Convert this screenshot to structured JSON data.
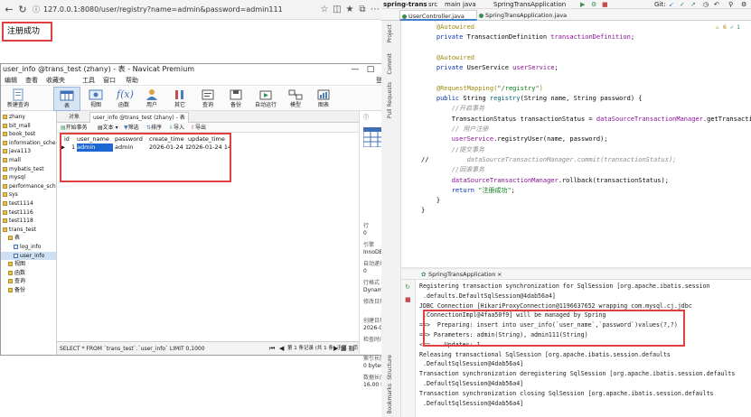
{
  "browser": {
    "url": "127.0.0.1:8080/user/registry?name=admin&password=admin111",
    "page_text": "注册成功"
  },
  "navicat": {
    "title": "user_info @trans_test (zhany) - 表 - Navicat Premium",
    "login": "登录",
    "menu": [
      "编辑",
      "查看",
      "收藏夹",
      "工具",
      "窗口",
      "帮助"
    ],
    "toolbar": [
      "新建查询",
      "表",
      "视图",
      "函数",
      "用户",
      "其它",
      "查询",
      "备份",
      "自动运行",
      "模型",
      "图表"
    ],
    "tabs": {
      "objects": "对象",
      "table": "user_info @trans_test (zhany) - 表"
    },
    "subtoolbar": [
      "开始事务",
      "文本",
      "筛选",
      "排序",
      "导入",
      "导出"
    ],
    "sidebar": [
      {
        "label": "zhany",
        "level": 0
      },
      {
        "label": "bit_mall",
        "level": 0
      },
      {
        "label": "book_test",
        "level": 0
      },
      {
        "label": "information_schema",
        "level": 0
      },
      {
        "label": "java113",
        "level": 0
      },
      {
        "label": "mall",
        "level": 0
      },
      {
        "label": "mybatis_test",
        "level": 0
      },
      {
        "label": "mysql",
        "level": 0
      },
      {
        "label": "performance_schema",
        "level": 0
      },
      {
        "label": "sys",
        "level": 0
      },
      {
        "label": "test1114",
        "level": 0
      },
      {
        "label": "test1116",
        "level": 0
      },
      {
        "label": "test1118",
        "level": 0
      },
      {
        "label": "trans_test",
        "level": 0
      },
      {
        "label": "表",
        "level": 1
      },
      {
        "label": "log_info",
        "level": 2
      },
      {
        "label": "user_info",
        "level": 2,
        "selected": true
      },
      {
        "label": "视图",
        "level": 1
      },
      {
        "label": "函数",
        "level": 1
      },
      {
        "label": "查询",
        "level": 1
      },
      {
        "label": "备份",
        "level": 1
      }
    ],
    "grid": {
      "columns": [
        "id",
        "user_name",
        "password",
        "create_time",
        "update_time"
      ],
      "rows": [
        [
          "1",
          "admin",
          "admin",
          "2026-01-24 14",
          "2026-01-24 14:"
        ]
      ]
    },
    "info": [
      {
        "k": "行",
        "v": "0"
      },
      {
        "k": "引擎",
        "v": "InnoDB"
      },
      {
        "k": "自动递增",
        "v": "0"
      },
      {
        "k": "行格式",
        "v": "Dynamic"
      },
      {
        "k": "修改日期",
        "v": ""
      },
      {
        "k": "创建日期",
        "v": "2026-01-2"
      },
      {
        "k": "检查时间",
        "v": ""
      },
      {
        "k": "索引长度",
        "v": "0 bytes (0)"
      },
      {
        "k": "数据长度",
        "v": "16.00 KB ("
      }
    ],
    "status": {
      "sql": "SELECT * FROM `trans_test`.`user_info` LIMIT 0,1000",
      "record": "第 1 条记录 (共 1 条) 于第 1 页"
    }
  },
  "ide": {
    "project": "spring-trans",
    "crumbs": [
      "src",
      "main",
      "java"
    ],
    "run_config": "SpringTransApplication",
    "tabs": [
      "UserController.java",
      "SpringTransApplication.java"
    ],
    "left_strip": [
      "Project",
      "Commit",
      "Pull Requests"
    ],
    "warnings": "6",
    "errors": "1",
    "code_lines": [
      [
        {
          "t": "    "
        },
        {
          "t": "@Autowired",
          "c": "ann"
        }
      ],
      [
        {
          "t": "    "
        },
        {
          "t": "private ",
          "c": "kw"
        },
        {
          "t": "TransactionDefinition "
        },
        {
          "t": "transactionDefinition",
          "c": "fd"
        },
        {
          "t": ";"
        }
      ],
      [
        {
          "t": ""
        }
      ],
      [
        {
          "t": "    "
        },
        {
          "t": "@Autowired",
          "c": "ann"
        }
      ],
      [
        {
          "t": "    "
        },
        {
          "t": "private ",
          "c": "kw"
        },
        {
          "t": "UserService "
        },
        {
          "t": "userService",
          "c": "fd"
        },
        {
          "t": ";"
        }
      ],
      [
        {
          "t": ""
        }
      ],
      [
        {
          "t": "    "
        },
        {
          "t": "@RequestMapping(",
          "c": "ann"
        },
        {
          "t": "\"/registry\"",
          "c": "str"
        },
        {
          "t": ")",
          "c": "ann"
        }
      ],
      [
        {
          "t": "    "
        },
        {
          "t": "public ",
          "c": "kw"
        },
        {
          "t": "String "
        },
        {
          "t": "registry",
          "c": "mth"
        },
        {
          "t": "(String name, String password) {"
        }
      ],
      [
        {
          "t": "        "
        },
        {
          "t": "//开启事务",
          "c": "cm"
        }
      ],
      [
        {
          "t": "        TransactionStatus transactionStatus = "
        },
        {
          "t": "dataSourceTransactionManager",
          "c": "fd"
        },
        {
          "t": ".getTransaction(tr"
        }
      ],
      [
        {
          "t": "        "
        },
        {
          "t": "// 用户注册",
          "c": "cm"
        }
      ],
      [
        {
          "t": "        "
        },
        {
          "t": "userService",
          "c": "fd"
        },
        {
          "t": ".registryUser(name, password);"
        }
      ],
      [
        {
          "t": "        "
        },
        {
          "t": "//提交事务",
          "c": "cm"
        }
      ],
      [
        {
          "t": "//          "
        },
        {
          "t": "dataSourceTransactionManager.commit(transactionStatus);",
          "c": "cm"
        }
      ],
      [
        {
          "t": "        "
        },
        {
          "t": "//回滚事务",
          "c": "cm"
        }
      ],
      [
        {
          "t": "        "
        },
        {
          "t": "dataSourceTransactionManager",
          "c": "fd"
        },
        {
          "t": ".rollback(transactionStatus);"
        }
      ],
      [
        {
          "t": "        "
        },
        {
          "t": "return ",
          "c": "kw"
        },
        {
          "t": "\"注册成功\"",
          "c": "str"
        },
        {
          "t": ";"
        }
      ],
      [
        {
          "t": "    }"
        }
      ],
      [
        {
          "t": "}"
        }
      ]
    ],
    "run_tab": "SpringTransApplication",
    "console": [
      "Registering transaction synchronization for SqlSession [org.apache.ibatis.session",
      ".defaults.DefaultSqlSession@4dab56a4]",
      "JDBC Connection [HikariProxyConnection@1196637652 wrapping com.mysql.cj.jdbc",
      ".ConnectionImpl@4faa50f9] will be managed by Spring",
      "==>  Preparing: insert into user_info(`user_name`,`password`)values(?,?)",
      "==> Parameters: admin(String), admin111(String)",
      "<==    Updates: 1",
      "Releasing transactional SqlSession [org.apache.ibatis.session.defaults",
      ".DefaultSqlSession@4dab56a4]",
      "Transaction synchronization deregistering SqlSession [org.apache.ibatis.session.defaults",
      ".DefaultSqlSession@4dab56a4]",
      "Transaction synchronization closing SqlSession [org.apache.ibatis.session.defaults",
      ".DefaultSqlSession@4dab56a4]"
    ],
    "bottom_strip": [
      "Structure",
      "Bookmarks"
    ]
  }
}
